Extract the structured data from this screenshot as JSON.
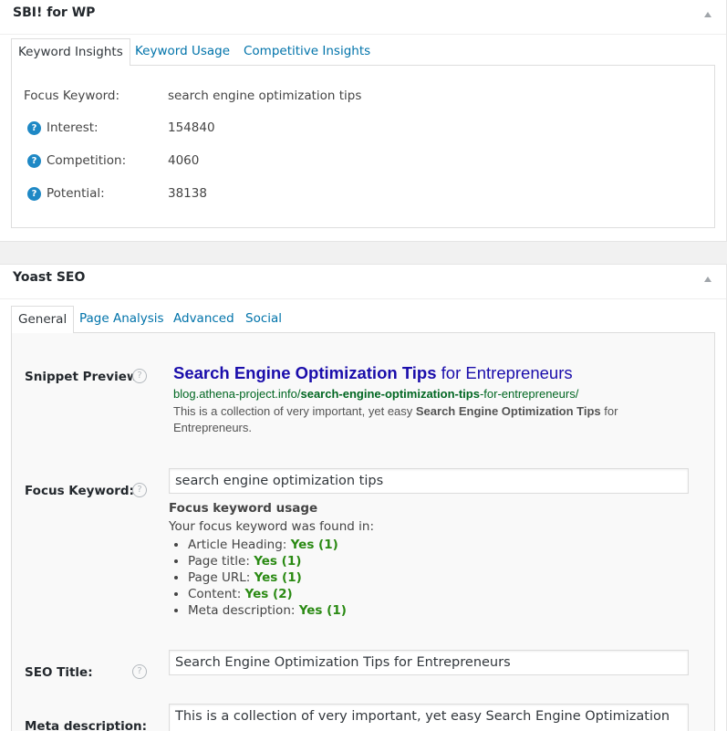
{
  "sbi": {
    "title": "SBI! for WP",
    "tabs": [
      "Keyword Insights",
      "Keyword Usage",
      "Competitive Insights"
    ],
    "focus_label": "Focus Keyword:",
    "focus_value": "search engine optimization tips",
    "rows": [
      {
        "label": "Interest:",
        "value": "154840"
      },
      {
        "label": "Competition:",
        "value": "4060"
      },
      {
        "label": "Potential:",
        "value": "38138"
      }
    ],
    "help_glyph": "?"
  },
  "yoast": {
    "title": "Yoast SEO",
    "tabs": [
      "General",
      "Page Analysis",
      "Advanced",
      "Social"
    ],
    "help_glyph": "?",
    "snippet": {
      "label": "Snippet Preview",
      "title_bold": "Search Engine Optimization Tips",
      "title_rest": " for Entrepreneurs",
      "url_prefix": "blog.athena-project.info/",
      "url_bold": "search-engine-optimization-tips",
      "url_rest": "-for-entrepreneurs/",
      "desc_prefix": "This is a collection of very important, yet easy ",
      "desc_bold": "Search Engine Optimization Tips",
      "desc_rest": " for Entrepreneurs."
    },
    "focus": {
      "label": "Focus Keyword:",
      "value": "search engine optimization tips",
      "usage_title": "Focus keyword usage",
      "usage_sub": "Your focus keyword was found in:",
      "items": [
        {
          "label": "Article Heading: ",
          "result": "Yes (1)"
        },
        {
          "label": "Page title: ",
          "result": "Yes (1)"
        },
        {
          "label": "Page URL: ",
          "result": "Yes (1)"
        },
        {
          "label": "Content: ",
          "result": "Yes (2)"
        },
        {
          "label": "Meta description: ",
          "result": "Yes (1)"
        }
      ]
    },
    "seo_title": {
      "label": "SEO Title:",
      "value": "Search Engine Optimization Tips for Entrepreneurs"
    },
    "meta": {
      "label": "Meta description:",
      "value": "This is a collection of very important, yet easy Search Engine Optimization"
    }
  },
  "colors": {
    "link": "#0073aa",
    "snippet_title": "#1a0dab",
    "snippet_url": "#006621",
    "yes_green": "#2a8a13",
    "help_blue": "#1e88c5"
  }
}
